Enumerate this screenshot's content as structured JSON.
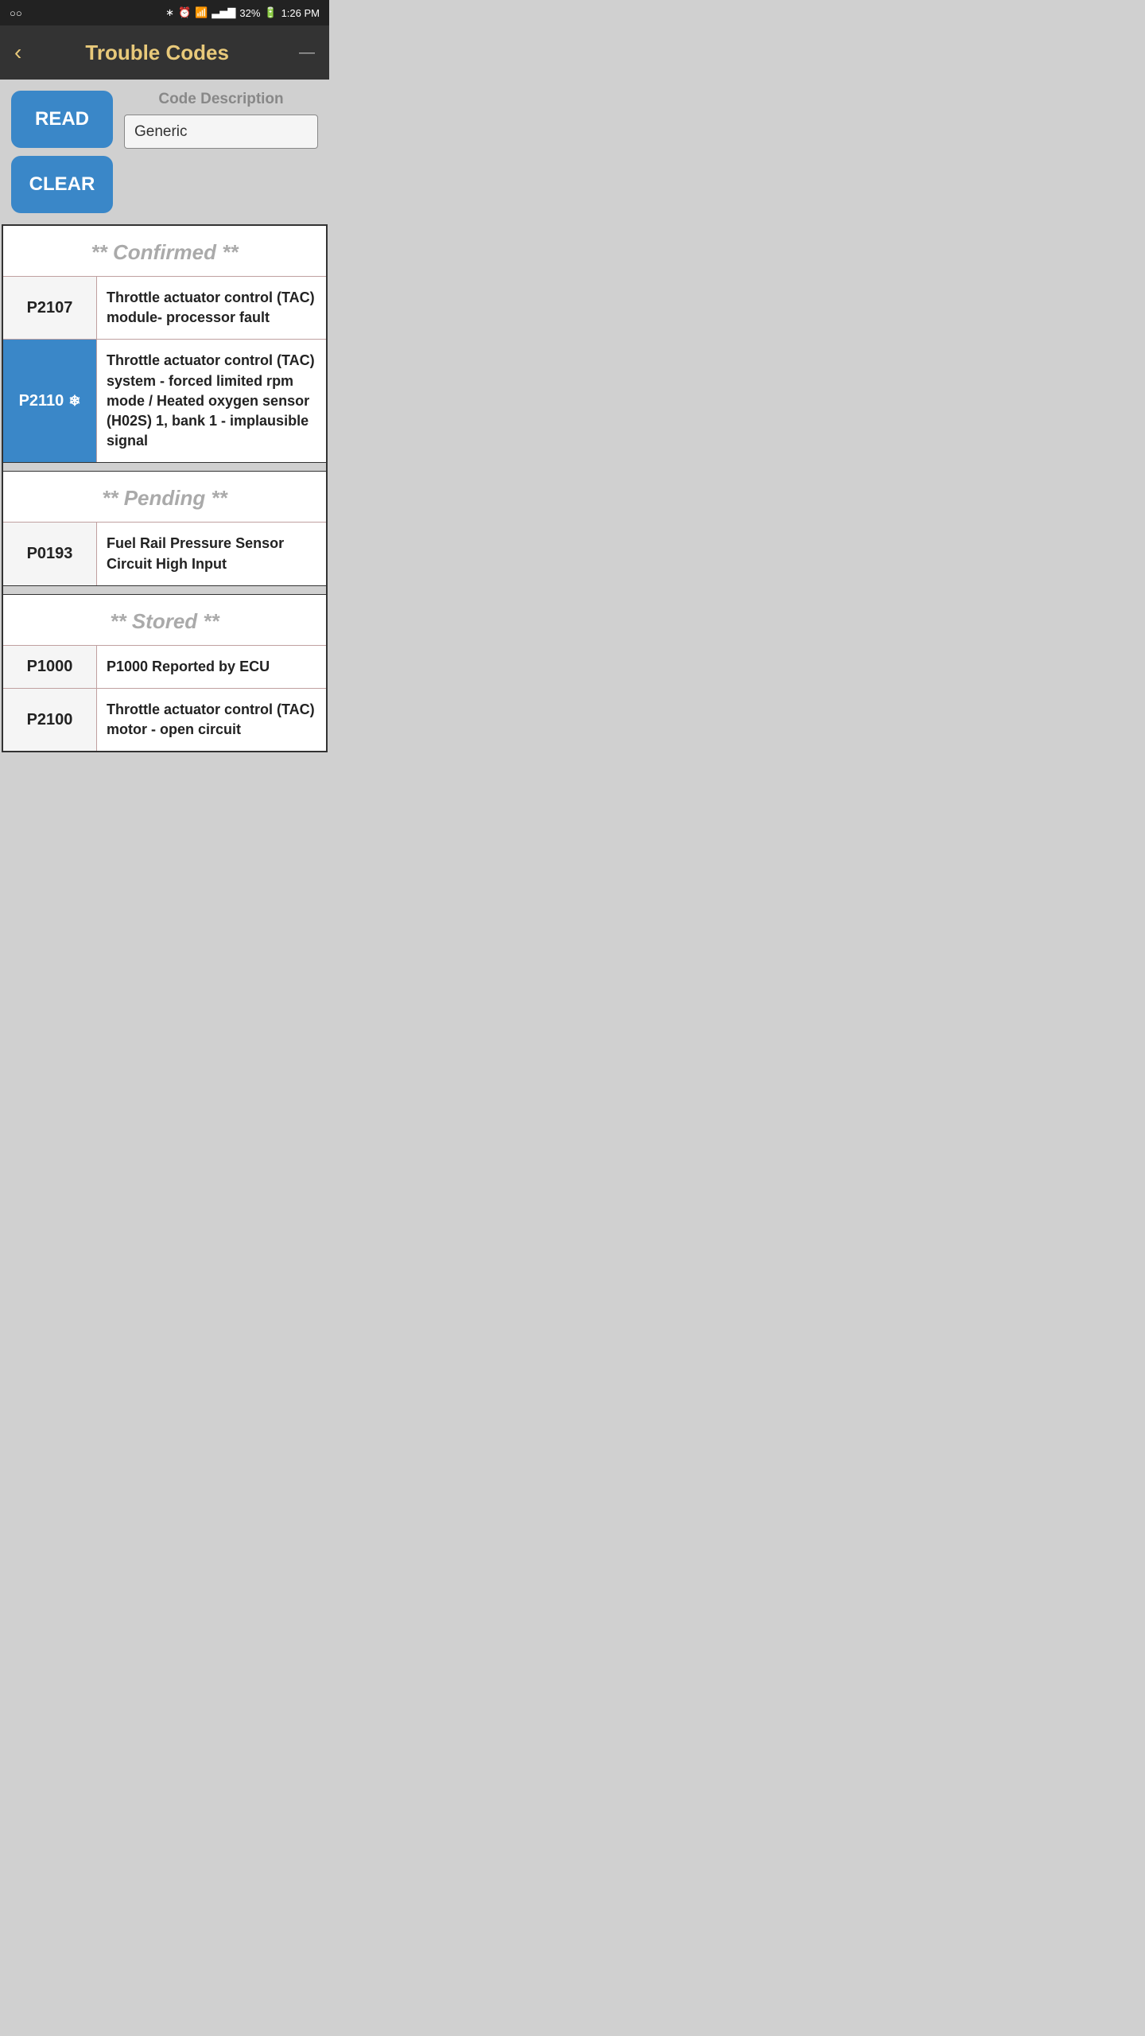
{
  "statusBar": {
    "leftIcon": "○○",
    "bluetooth": "BT",
    "alarm": "⏰",
    "wifi": "WiFi",
    "signal": "📶",
    "battery": "32%",
    "time": "1:26 PM"
  },
  "header": {
    "backLabel": "‹",
    "title": "Trouble Codes",
    "menuIcon": "—"
  },
  "controls": {
    "readLabel": "READ",
    "clearLabel": "CLEAR",
    "codeDescLabel": "Code Description",
    "codeDescValue": "Generic"
  },
  "sections": [
    {
      "name": "confirmed",
      "label": "** Confirmed **",
      "codes": [
        {
          "code": "P2107",
          "description": "Throttle actuator control (TAC) module- processor fault",
          "highlight": false
        },
        {
          "code": "P2110",
          "description": "Throttle actuator control (TAC) system - forced limited rpm mode / Heated oxygen sensor (H02S) 1, bank 1 - implausible signal",
          "highlight": true,
          "snowflake": true
        }
      ]
    },
    {
      "name": "pending",
      "label": "** Pending **",
      "codes": [
        {
          "code": "P0193",
          "description": "Fuel Rail Pressure Sensor Circuit High Input",
          "highlight": false
        }
      ]
    },
    {
      "name": "stored",
      "label": "** Stored **",
      "codes": [
        {
          "code": "P1000",
          "description": "P1000 Reported by ECU",
          "highlight": false
        },
        {
          "code": "P2100",
          "description": "Throttle actuator control (TAC) motor - open circuit",
          "highlight": false
        }
      ]
    }
  ]
}
